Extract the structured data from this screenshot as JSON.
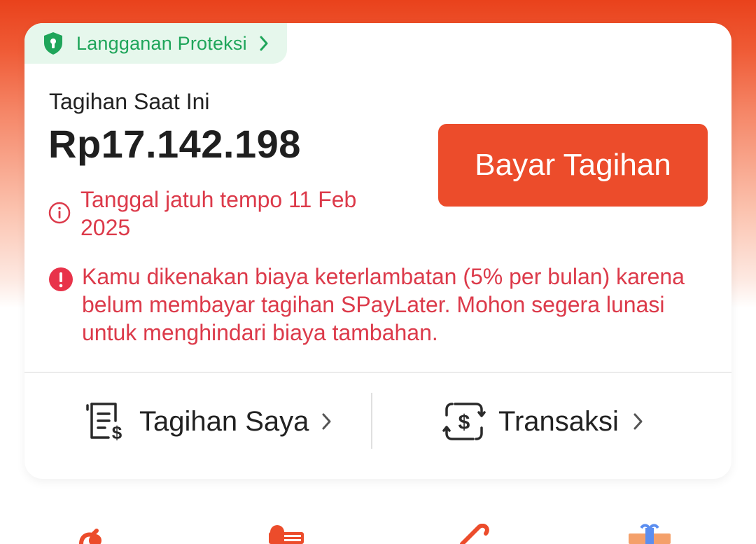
{
  "colors": {
    "accent": "#ec4c2b",
    "alert_text": "#dc3a4a",
    "protection_green": "#1fa55a",
    "protection_bg": "#e6f7ec"
  },
  "protection_tag": {
    "label": "Langganan Proteksi",
    "icon": "shield-lock-icon"
  },
  "bill": {
    "label": "Tagihan Saat Ini",
    "amount": "Rp17.142.198",
    "pay_button_label": "Bayar Tagihan",
    "due_text": "Tanggal jatuh tempo 11 Feb 2025",
    "late_fee_warning": "Kamu dikenakan biaya keterlambatan (5% per bulan) karena belum membayar tagihan SPayLater. Mohon segera lunasi untuk menghindari biaya tambahan."
  },
  "quick_links": [
    {
      "label": "Tagihan Saya",
      "icon": "bill-list-icon"
    },
    {
      "label": "Transaksi",
      "icon": "transaction-icon"
    }
  ],
  "bottom_menu_icons": [
    "menu-icon-1",
    "menu-icon-2",
    "menu-icon-3",
    "gift-icon"
  ]
}
